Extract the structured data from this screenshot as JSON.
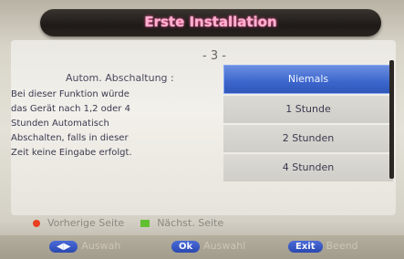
{
  "title": "Erste Installation",
  "page_indicator": "- 3 -",
  "setting_label": "Autom. Abschaltung :",
  "help_lines": [
    "Bei dieser Funktion würde",
    "das Gerät nach 1,2 oder 4",
    "Stunden Automatisch",
    "Abschalten, falls in dieser",
    "Zeit keine Eingabe erfolgt."
  ],
  "options": [
    {
      "label": "Niemals",
      "selected": true
    },
    {
      "label": "1 Stunde",
      "selected": false
    },
    {
      "label": "2 Stunden",
      "selected": false
    },
    {
      "label": "4 Stunden",
      "selected": false
    }
  ],
  "legend": {
    "prev_label": "Vorherige Seite",
    "next_label": "Nächst. Seite"
  },
  "bottom_buttons": [
    {
      "key": "◀▶",
      "label": "Auswah"
    },
    {
      "key": "Ok",
      "label": "Auswahl"
    },
    {
      "key": "Exit",
      "label": "Beend"
    }
  ],
  "colors": {
    "accent": "#3c66cc",
    "title_text": "#ffb0d0",
    "prev_marker": "#e84020",
    "next_marker": "#60c030"
  }
}
